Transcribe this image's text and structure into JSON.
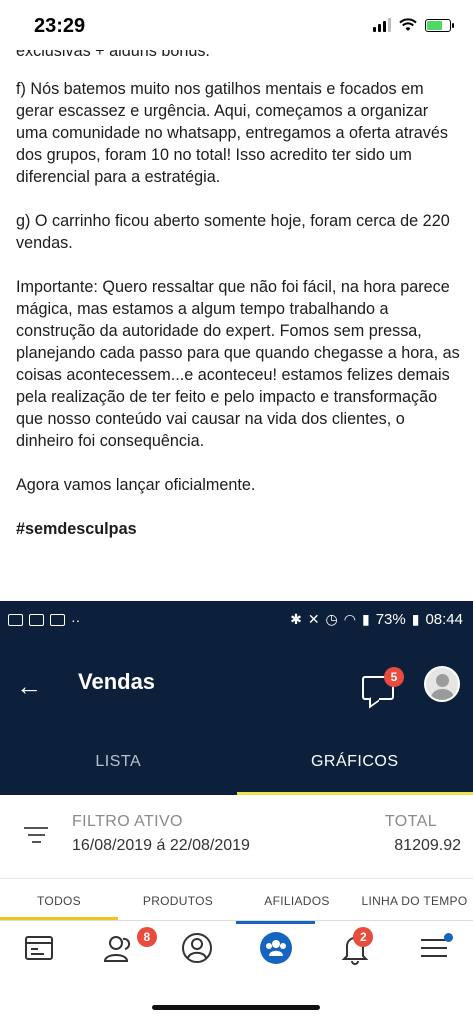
{
  "ios_status": {
    "time": "23:29"
  },
  "message": {
    "cut_line": "exclusivas + alguns bônus.",
    "paragraphs": [
      "f) Nós batemos muito nos gatilhos mentais e focados em gerar escassez e urgência. Aqui, começamos a organizar uma comunidade no whatsapp, entregamos a oferta através dos grupos, foram 10 no total! Isso acredito ter sido um diferencial para a estratégia.",
      "g) O carrinho ficou aberto somente hoje, foram cerca de 220 vendas.",
      "Importante: Quero ressaltar que não foi fácil, na hora parece mágica, mas estamos a algum tempo trabalhando a construção da autoridade do expert. Fomos sem pressa, planejando cada passo para que quando chegasse a hora, as coisas acontecessem...e aconteceu! estamos felizes demais pela realização de ter feito e pelo impacto e transformação que nosso conteúdo vai causar na vida dos clientes, o dinheiro foi consequência.",
      "Agora vamos lançar oficialmente."
    ],
    "hashtag": "#semdesculpas"
  },
  "android_status": {
    "battery": "73%",
    "time": "08:44"
  },
  "appbar": {
    "title": "Vendas",
    "chat_badge": "5"
  },
  "tabs": [
    {
      "label": "LISTA"
    },
    {
      "label": "GRÁFICOS"
    }
  ],
  "filter": {
    "label": "FILTRO ATIVO",
    "value": "16/08/2019 á 22/08/2019",
    "total_label": "TOTAL",
    "total_value": "81209.92"
  },
  "sub_tabs": [
    {
      "label": "TODOS"
    },
    {
      "label": "PRODUTOS"
    },
    {
      "label": "AFILIADOS"
    },
    {
      "label": "LINHA DO TEMPO"
    }
  ],
  "bottom_nav": {
    "users_badge": "8",
    "bell_badge": "2",
    "items": [
      "sales-icon",
      "users-icon",
      "profile-icon",
      "community-icon",
      "bell-icon",
      "menu-icon"
    ]
  },
  "colors": {
    "navy": "#0c1f3b",
    "accent_yellow": "#f0e14a",
    "blue": "#1565c0",
    "badge_red": "#e74c3c"
  }
}
